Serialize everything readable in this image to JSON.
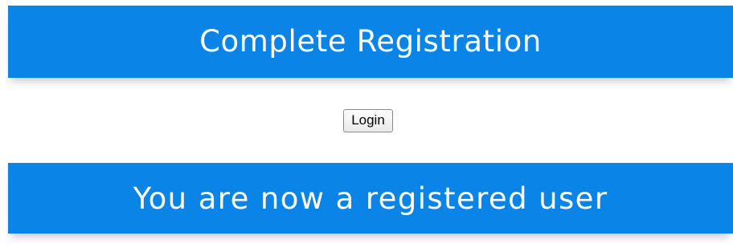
{
  "header": {
    "title": "Complete Registration"
  },
  "actions": {
    "login_label": "Login"
  },
  "status": {
    "message": "You are now a registered user"
  },
  "colors": {
    "banner": "#0a84e6",
    "banner_text": "#ffffff",
    "background": "#ffffff"
  }
}
